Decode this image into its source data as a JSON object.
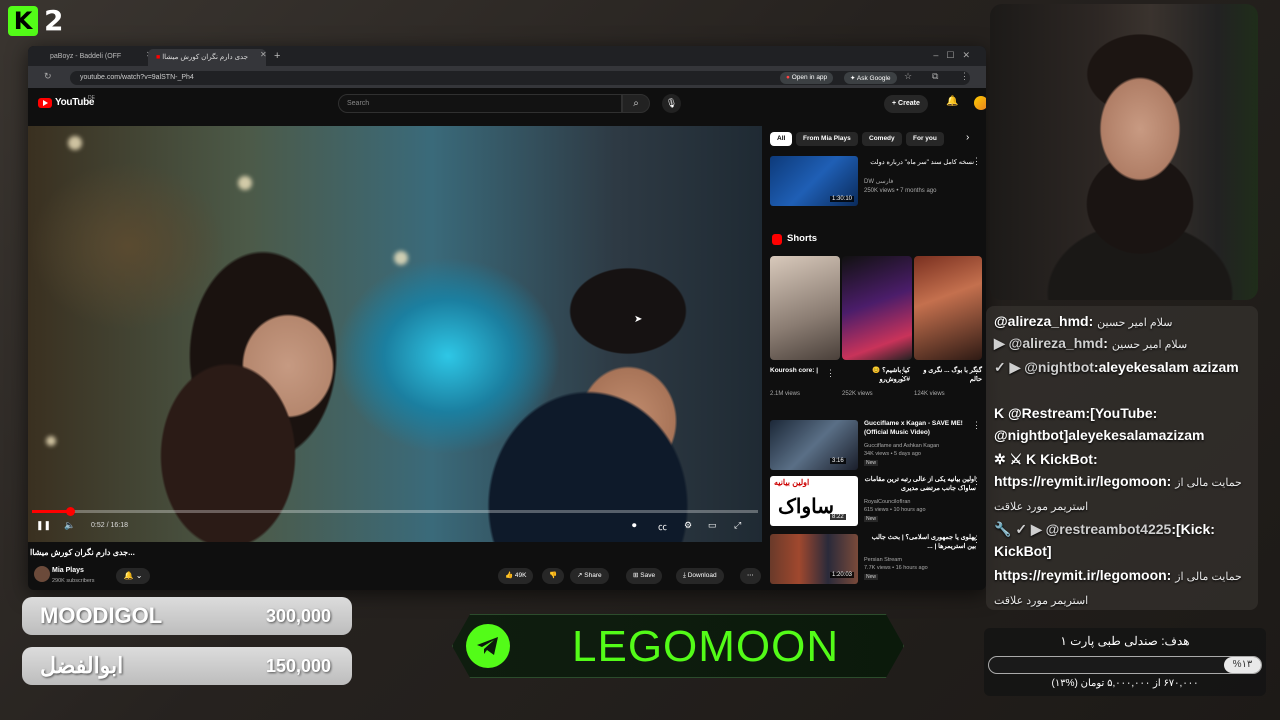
{
  "stream": {
    "platform_badge": "K",
    "viewer_count": "2"
  },
  "browser": {
    "tabs": [
      {
        "label": "paBoyz - Baddeli (OFF",
        "active": false
      },
      {
        "label": "جدی دارم نگران کورش میشاا",
        "active": true
      }
    ],
    "url": "youtube.com/watch?v=9alSTN-_Ph4",
    "open_in_app": "Open in app",
    "ask_google": "Ask Google"
  },
  "youtube": {
    "logo": "YouTube",
    "region": "DE",
    "search_placeholder": "Search",
    "create": "Create",
    "video": {
      "current_time": "0:52",
      "duration": "16:18",
      "progress": 0.053,
      "title": "جدی دارم نگران کورش میشاا...",
      "channel": "Mia Plays",
      "subscribers": "290K subscribers",
      "likes": "49K",
      "share": "Share",
      "save": "Save",
      "download": "Download"
    },
    "chips": [
      "All",
      "From Mia Plays",
      "Comedy",
      "For you"
    ],
    "top_rec": {
      "title": "نسخه کامل سند \"سر ماه\" درباره دولت",
      "duration": "1:30:10",
      "channel": "DW فارسی",
      "meta": "250K views • 7 months ago"
    },
    "shorts_heading": "Shorts",
    "shorts": [
      {
        "title": "Kourosh core: |",
        "views": "2.1M views"
      },
      {
        "title": "کیا باشیم؟ 😊 #کوروش‌رو",
        "views": "252K views"
      },
      {
        "title": "گنگر با بوگ ... نگری و حالم",
        "views": "124K views"
      }
    ],
    "recs": [
      {
        "title": "Gucciflame x Kagan - SAVE ME! (Official Music Video)",
        "channel": "Gucciflame and Ashkan Kagan",
        "meta": "34K views • 5 days ago",
        "duration": "3:16",
        "badge": "New"
      },
      {
        "title": "اولین بیانیه یکی از عالی رتبه ترین مقامات ساواک جانب مرتضی مدیری",
        "channel": "RoyalCouncilofIran",
        "meta": "615 views • 10 hours ago",
        "duration": "8:22",
        "badge": "New",
        "thumb_text": "ساواک",
        "thumb_caption": "اولین بیانیه"
      },
      {
        "title": "پهلوی یا جمهوری اسلامی؟ | بحث جالب بین استریمرها | ...",
        "channel": "Persian Stream",
        "meta": "7.7K views • 16 hours ago",
        "duration": "1:20:03",
        "badge": "New"
      }
    ]
  },
  "chat": [
    {
      "user": "@alireza_hmd",
      "text": "سلام امیر حسین"
    },
    {
      "user": "@alireza_hmd",
      "text": "سلام امیر حسین"
    },
    {
      "user": "@nightbot",
      "text": "aleyekesalam azizam"
    },
    {
      "user": "@Restream",
      "text": "[YouTube: @nightbot]aleyekesalamazizam"
    },
    {
      "user": "KickBot",
      "text": "https://reymit.ir/legomoon:",
      "fa": "حمایت مالی از استریمر مورد علاقت"
    },
    {
      "user": "@restreambot4225",
      "text": "[Kick: KickBot]"
    },
    {
      "user": "",
      "text": "https://reymit.ir/legomoon:",
      "fa": "حمایت مالی از استریمر مورد علاقت"
    }
  ],
  "goal": {
    "title": "هدف: صندلی طبی پارت ۱",
    "percent_label": "%۱۳",
    "progress": 0.13,
    "subtitle": "۶۷۰,۰۰۰ از ۵,۰۰۰,۰۰۰ تومان (%۱۳)"
  },
  "donors": [
    {
      "name": "MOODIGOL",
      "amount": "300,000"
    },
    {
      "name": "ابوالفضل",
      "amount": "150,000"
    }
  ],
  "telegram": {
    "handle": "LEGOMOON",
    "icon": "telegram-icon",
    "color": "#53fc18"
  }
}
